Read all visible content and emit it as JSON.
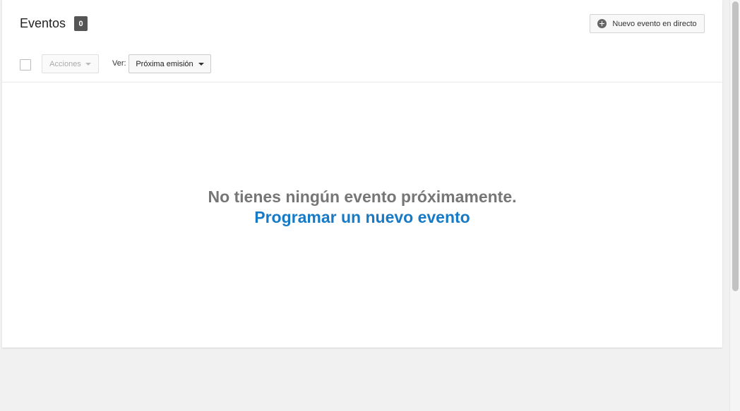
{
  "header": {
    "title": "Eventos",
    "count": "0",
    "new_event_label": "Nuevo evento en directo"
  },
  "toolbar": {
    "actions_label": "Acciones",
    "view_label": "Ver:",
    "view_selected": "Próxima emisión"
  },
  "empty_state": {
    "message": "No tienes ningún evento próximamente.",
    "link_label": "Programar un nuevo evento"
  },
  "icons": {
    "new_event": "plus-circle-icon",
    "dropdown": "caret-down-icon"
  },
  "colors": {
    "link": "#167ac6",
    "message": "#767676",
    "badge_bg": "#555555"
  }
}
